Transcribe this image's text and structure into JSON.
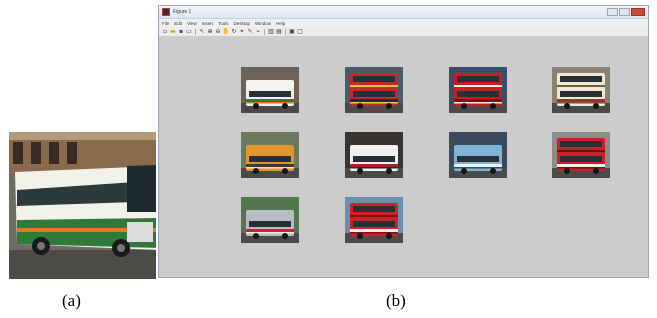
{
  "query_image": {
    "icon": "bus-photo"
  },
  "window": {
    "title": "Figure 1",
    "menu": [
      "File",
      "Edit",
      "View",
      "Insert",
      "Tools",
      "Desktop",
      "Window",
      "Help"
    ],
    "toolbar_icons": [
      "new-file-icon",
      "open-folder-icon",
      "save-icon",
      "print-icon",
      "pointer-icon",
      "zoom-in-icon",
      "zoom-out-icon",
      "pan-icon",
      "rotate-icon",
      "data-cursor-icon",
      "brush-icon",
      "link-icon",
      "colorbar-icon",
      "legend-icon",
      "hide-plot-tools-icon",
      "show-plot-tools-icon"
    ]
  },
  "results": [
    {
      "body": "#f4f2ec",
      "stripe": "#2f7a3a",
      "stripe2": "#e07a1a",
      "bg": "#6e6257",
      "double": false
    },
    {
      "body": "#c8262a",
      "stripe": "#2a2a2a",
      "stripe2": "#e8c84a",
      "bg": "#4d5a6b",
      "double": true
    },
    {
      "body": "#c81e22",
      "stripe": "#7a1010",
      "stripe2": "#f0f0f0",
      "bg": "#3c4e68",
      "double": true
    },
    {
      "body": "#efe8d5",
      "stripe": "#b3262a",
      "stripe2": "#7a5a3a",
      "bg": "#8a8270",
      "double": true
    },
    {
      "body": "#e4952a",
      "stripe": "#3a3a3a",
      "stripe2": "#e8e3d8",
      "bg": "#6b7a5e",
      "double": false
    },
    {
      "body": "#f1f1f1",
      "stripe": "#a8232a",
      "stripe2": "#2a2a2a",
      "bg": "#3a3430",
      "double": false
    },
    {
      "body": "#7fb3d6",
      "stripe": "#f1f1f1",
      "stripe2": "#2f4a70",
      "bg": "#3a4a5c",
      "double": false
    },
    {
      "body": "#c42428",
      "stripe": "#f2f2f2",
      "stripe2": "#6b1010",
      "bg": "#8e8c86",
      "double": true
    },
    {
      "body": "#b9bcc2",
      "stripe": "#c02a2c",
      "stripe2": "#ececec",
      "bg": "#55774f",
      "double": false
    },
    {
      "body": "#cc2226",
      "stripe": "#f0f0f0",
      "stripe2": "#7a1010",
      "bg": "#6b8fb3",
      "double": true
    }
  ],
  "captions": {
    "a": "(a)",
    "b": "(b)"
  }
}
